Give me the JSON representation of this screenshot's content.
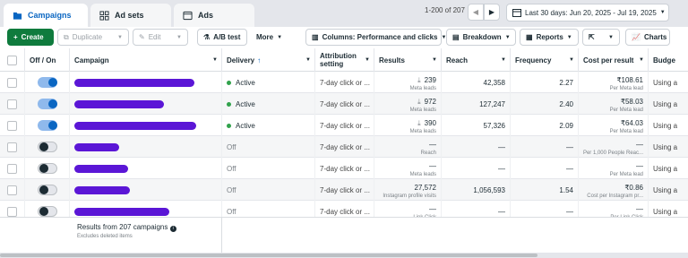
{
  "tabs": [
    {
      "label": "Campaigns",
      "icon": "folder-icon"
    },
    {
      "label": "Ad sets",
      "icon": "grid-icon"
    },
    {
      "label": "Ads",
      "icon": "ad-icon"
    }
  ],
  "pager": {
    "text": "1-200 of 207"
  },
  "date_range": {
    "label": "Last 30 days: Jun 20, 2025 - Jul 19, 2025"
  },
  "toolbar": {
    "create": "Create",
    "duplicate": "Duplicate",
    "edit": "Edit",
    "ab_test": "A/B test",
    "more": "More",
    "columns": "Columns: Performance and clicks",
    "breakdown": "Breakdown",
    "reports": "Reports",
    "charts": "Charts"
  },
  "columns": [
    "Off / On",
    "Campaign",
    "Delivery",
    "Attribution setting",
    "Results",
    "Reach",
    "Frequency",
    "Cost per result",
    "Budge"
  ],
  "rows": [
    {
      "on": true,
      "delivery": "Active",
      "attribution": "7-day click or ...",
      "results": "239",
      "results_sub": "Meta leads",
      "reach": "42,358",
      "frequency": "2.27",
      "cost": "₹108.61",
      "cost_sub": "Per Meta lead",
      "budget": "Using a"
    },
    {
      "on": true,
      "delivery": "Active",
      "attribution": "7-day click or ...",
      "results": "972",
      "results_sub": "Meta leads",
      "reach": "127,247",
      "frequency": "2.40",
      "cost": "₹58.03",
      "cost_sub": "Per Meta lead",
      "budget": "Using a"
    },
    {
      "on": true,
      "delivery": "Active",
      "attribution": "7-day click or ...",
      "results": "390",
      "results_sub": "Meta leads",
      "reach": "57,326",
      "frequency": "2.09",
      "cost": "₹64.03",
      "cost_sub": "Per Meta lead",
      "budget": "Using a"
    },
    {
      "on": false,
      "delivery": "Off",
      "attribution": "7-day click or ...",
      "results": "—",
      "results_sub": "Reach",
      "reach": "—",
      "frequency": "—",
      "cost": "—",
      "cost_sub": "Per 1,000 People Reac...",
      "budget": "Using a"
    },
    {
      "on": false,
      "delivery": "Off",
      "attribution": "7-day click or ...",
      "results": "—",
      "results_sub": "Meta leads",
      "reach": "—",
      "frequency": "—",
      "cost": "—",
      "cost_sub": "Per Meta lead",
      "budget": "Using a"
    },
    {
      "on": false,
      "delivery": "Off",
      "attribution": "7-day click or ...",
      "results": "27,572",
      "results_sub": "Instagram profile visits",
      "reach": "1,056,593",
      "frequency": "1.54",
      "cost": "₹0.86",
      "cost_sub": "Cost per Instagram pr...",
      "budget": "Using a"
    },
    {
      "on": false,
      "delivery": "Off",
      "attribution": "7-day click or ...",
      "results": "—",
      "results_sub": "Link Click",
      "reach": "—",
      "frequency": "—",
      "cost": "—",
      "cost_sub": "Per Link Click",
      "budget": "Using a"
    }
  ],
  "footer": {
    "summary": "Results from 207 campaigns",
    "note": "Excludes deleted items"
  },
  "colors": {
    "accent": "#0a66c2",
    "create": "#0f7b3d",
    "redaction": "#5b16d6",
    "active": "#31a24c"
  }
}
